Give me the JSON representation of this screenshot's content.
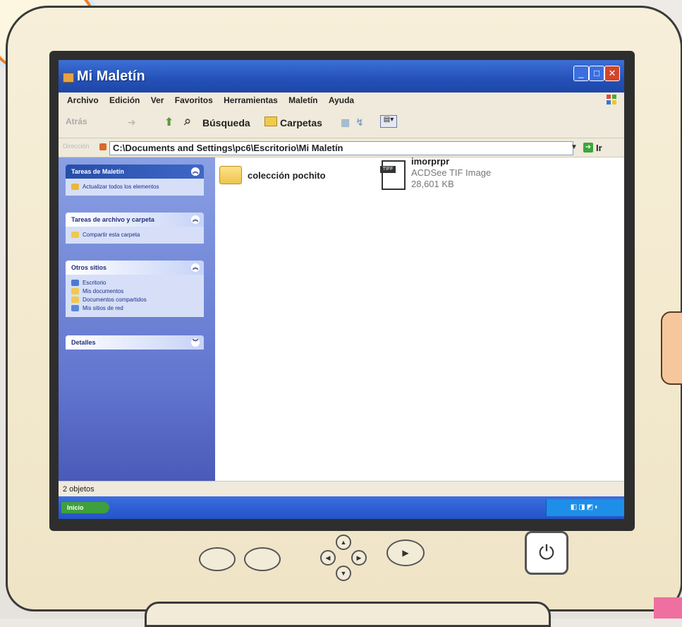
{
  "window": {
    "title": "Mi Maletín",
    "buttons": {
      "minimize": "_",
      "maximize": "□",
      "close": "✕"
    }
  },
  "menubar": [
    "Archivo",
    "Edición",
    "Ver",
    "Favoritos",
    "Herramientas",
    "Maletín",
    "Ayuda"
  ],
  "toolbar": {
    "back": "Atrás",
    "search": "Búsqueda",
    "folders": "Carpetas"
  },
  "address": {
    "label": "Dirección",
    "path": "C:\\Documents and Settings\\pc6\\Escritorio\\Mi Maletín",
    "go": "Ir"
  },
  "taskpane": {
    "panels": [
      {
        "title": "Tareas de Maletín",
        "items": [
          "Actualizar todos los elementos"
        ]
      },
      {
        "title": "Tareas de archivo y carpeta",
        "items": [
          "Compartir esta carpeta"
        ]
      },
      {
        "title": "Otros sitios",
        "items": [
          "Escritorio",
          "Mis documentos",
          "Documentos compartidos",
          "Mis sitios de red"
        ]
      },
      {
        "title": "Detalles",
        "items": []
      }
    ]
  },
  "files": [
    {
      "name": "colección pochito",
      "type": "folder"
    },
    {
      "name": "imorprpr",
      "type": "ACDSee TIF Image",
      "size": "28,601 KB",
      "icon_label": "TIFF"
    }
  ],
  "status": {
    "text": "2 objetos"
  },
  "taskbar": {
    "start": "Inicio"
  },
  "colors": {
    "title": "#2451b8",
    "taskpane": "#6275cf",
    "folder": "#eec54b"
  }
}
